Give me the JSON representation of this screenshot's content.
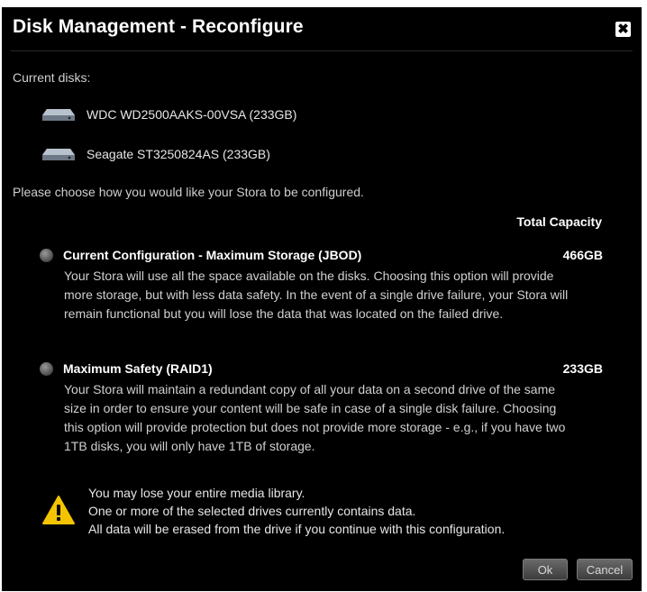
{
  "dialog": {
    "title": "Disk Management - Reconfigure",
    "close_glyph": "✖"
  },
  "disks": {
    "label": "Current disks:",
    "items": [
      {
        "name": "WDC WD2500AAKS-00VSA  (233GB)",
        "icon": "hard-drive-icon"
      },
      {
        "name": "Seagate ST3250824AS  (233GB)",
        "icon": "hard-drive-icon"
      }
    ]
  },
  "prompt": "Please choose how you would like your Stora to be configured.",
  "capacity_header": "Total Capacity",
  "options": [
    {
      "title": "Current Configuration - Maximum Storage (JBOD)",
      "capacity": "466GB",
      "description": "Your Stora will use all the space available on the disks. Choosing this option will provide more storage, but with less data safety. In the event of a single drive failure, your Stora will remain functional but you will lose the data that was located on the failed drive."
    },
    {
      "title": "Maximum Safety (RAID1)",
      "capacity": "233GB",
      "description": "Your Stora will maintain a redundant copy of all your data on a second drive of the same size in order to ensure your content will be safe in case of a single disk failure. Choosing this option will provide protection but does not provide more storage - e.g., if you have two 1TB disks, you will only have 1TB of storage."
    }
  ],
  "warning": {
    "icon": "warning-icon",
    "line1": "You may lose your entire media library.",
    "line2": "One or more of the selected drives currently contains data.",
    "line3": "All data will be erased from the drive if you continue with this configuration."
  },
  "buttons": {
    "ok": "Ok",
    "cancel": "Cancel"
  },
  "colors": {
    "background": "#000000",
    "text": "#d8d8d8",
    "warning": "#f5c400"
  }
}
